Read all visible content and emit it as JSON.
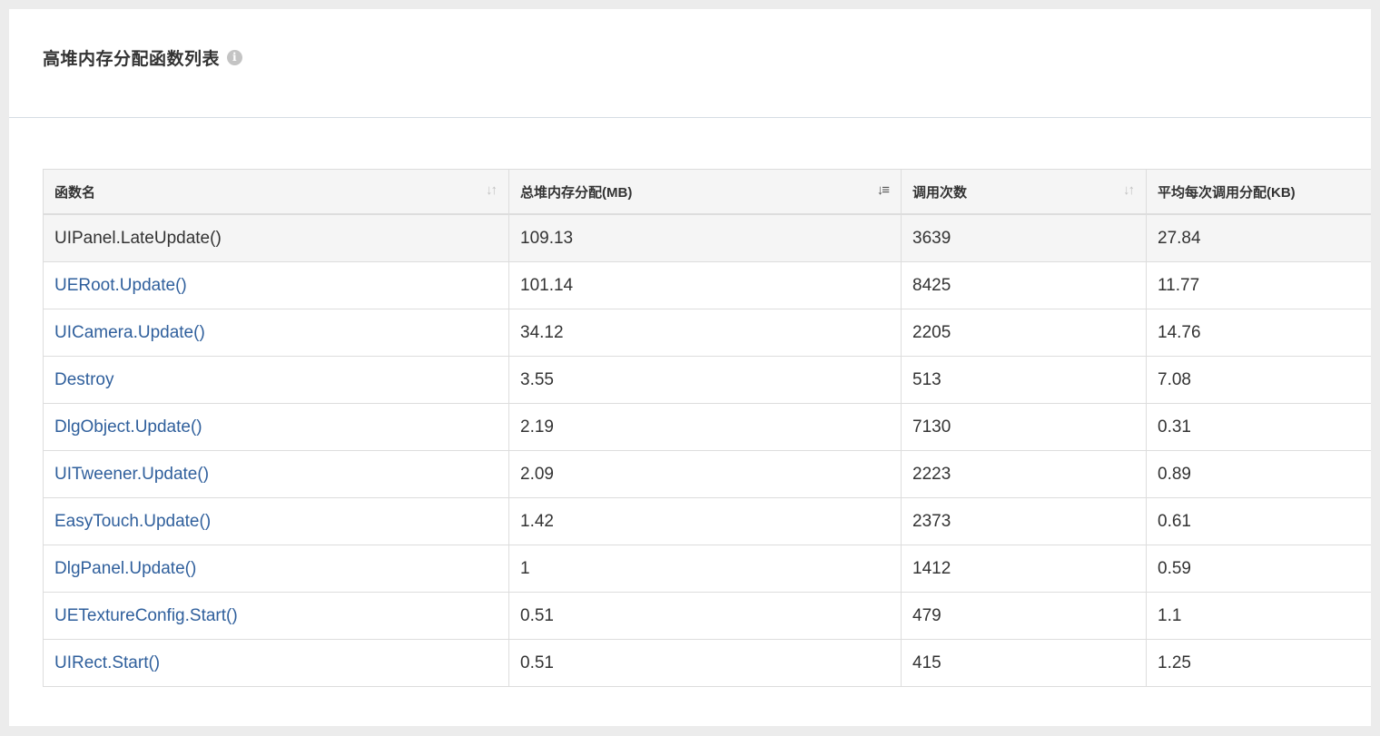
{
  "panel": {
    "title": "高堆内存分配函数列表",
    "info_icon": "info-circle-icon"
  },
  "table": {
    "columns": [
      {
        "label": "函数名",
        "sort": "unsorted"
      },
      {
        "label": "总堆内存分配(MB)",
        "sort": "descending"
      },
      {
        "label": "调用次数",
        "sort": "unsorted"
      },
      {
        "label": "平均每次调用分配(KB)",
        "sort": "none"
      }
    ],
    "rows": [
      {
        "name": "UIPanel.LateUpdate()",
        "total_mb": "109.13",
        "calls": "3639",
        "avg_kb": "27.84"
      },
      {
        "name": "UERoot.Update()",
        "total_mb": "101.14",
        "calls": "8425",
        "avg_kb": "11.77"
      },
      {
        "name": "UICamera.Update()",
        "total_mb": "34.12",
        "calls": "2205",
        "avg_kb": "14.76"
      },
      {
        "name": "Destroy",
        "total_mb": "3.55",
        "calls": "513",
        "avg_kb": "7.08"
      },
      {
        "name": "DlgObject.Update()",
        "total_mb": "2.19",
        "calls": "7130",
        "avg_kb": "0.31"
      },
      {
        "name": "UITweener.Update()",
        "total_mb": "2.09",
        "calls": "2223",
        "avg_kb": "0.89"
      },
      {
        "name": "EasyTouch.Update()",
        "total_mb": "1.42",
        "calls": "2373",
        "avg_kb": "0.61"
      },
      {
        "name": "DlgPanel.Update()",
        "total_mb": "1",
        "calls": "1412",
        "avg_kb": "0.59"
      },
      {
        "name": "UETextureConfig.Start()",
        "total_mb": "0.51",
        "calls": "479",
        "avg_kb": "1.1"
      },
      {
        "name": "UIRect.Start()",
        "total_mb": "0.51",
        "calls": "415",
        "avg_kb": "1.25"
      }
    ]
  },
  "colors": {
    "link": "#2f5f9c",
    "header_bg": "#f5f5f5",
    "border": "#dddddd"
  }
}
